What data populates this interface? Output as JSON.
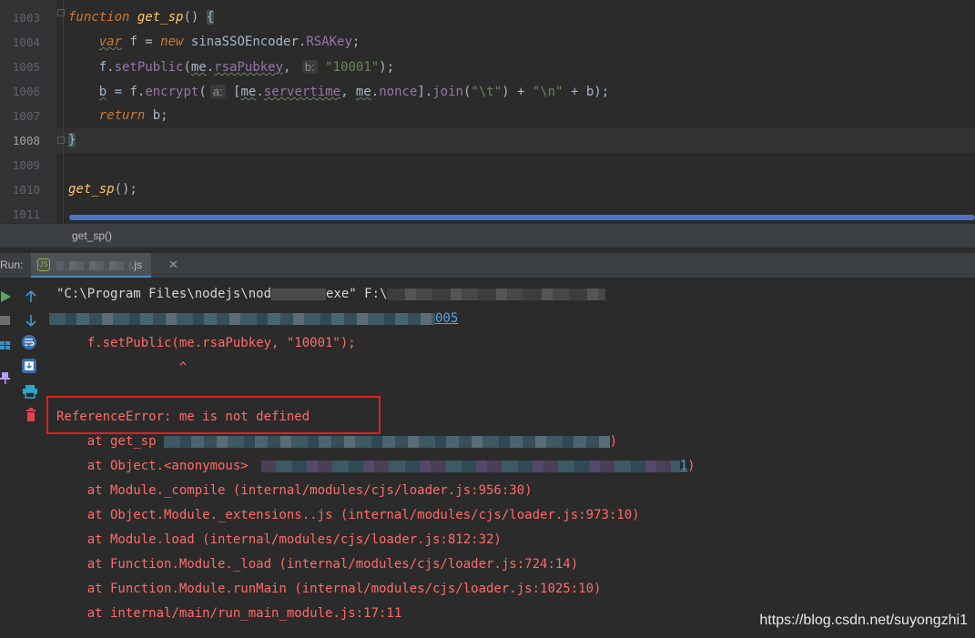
{
  "editor": {
    "line_numbers": [
      "1003",
      "1004",
      "1005",
      "1006",
      "1007",
      "1008",
      "1009",
      "1010",
      "1011"
    ],
    "current_line": "1008",
    "lines": [
      {
        "parts": [
          {
            "t": "function",
            "c": "kw"
          },
          {
            "t": " "
          },
          {
            "t": "get_sp",
            "c": "fn"
          },
          {
            "t": "() "
          },
          {
            "t": "{",
            "c": "brace-match"
          }
        ]
      },
      {
        "parts": [
          {
            "t": "    "
          },
          {
            "t": "var",
            "c": "kw squig"
          },
          {
            "t": " f = "
          },
          {
            "t": "new",
            "c": "kw"
          },
          {
            "t": " sinaSSOEncoder."
          },
          {
            "t": "RSAKey",
            "c": "prop"
          },
          {
            "t": ";"
          }
        ]
      },
      {
        "parts": [
          {
            "t": "    f."
          },
          {
            "t": "setPublic",
            "c": "prop"
          },
          {
            "t": "("
          },
          {
            "t": "me",
            "c": "squig"
          },
          {
            "t": "."
          },
          {
            "t": "rsaPubkey",
            "c": "prop squig"
          },
          {
            "t": ", "
          },
          {
            "t": "b:",
            "c": "hint"
          },
          {
            "t": " "
          },
          {
            "t": "\"10001\"",
            "c": "str"
          },
          {
            "t": ");"
          }
        ]
      },
      {
        "parts": [
          {
            "t": "    "
          },
          {
            "t": "b",
            "c": "squig"
          },
          {
            "t": " = f."
          },
          {
            "t": "encrypt",
            "c": "prop"
          },
          {
            "t": "("
          },
          {
            "t": "a:",
            "c": "hint"
          },
          {
            "t": " ["
          },
          {
            "t": "me",
            "c": "squig"
          },
          {
            "t": "."
          },
          {
            "t": "servertime",
            "c": "prop squig"
          },
          {
            "t": ", "
          },
          {
            "t": "me",
            "c": "squig"
          },
          {
            "t": "."
          },
          {
            "t": "nonce",
            "c": "prop"
          },
          {
            "t": "]."
          },
          {
            "t": "join",
            "c": "prop"
          },
          {
            "t": "("
          },
          {
            "t": "\"\\t\"",
            "c": "str"
          },
          {
            "t": ") + "
          },
          {
            "t": "\"\\n\"",
            "c": "str"
          },
          {
            "t": " + b);"
          }
        ]
      },
      {
        "parts": [
          {
            "t": "    "
          },
          {
            "t": "return",
            "c": "kw"
          },
          {
            "t": " b;"
          }
        ]
      },
      {
        "parts": [
          {
            "t": "}",
            "c": "brace-match"
          }
        ]
      },
      {
        "parts": []
      },
      {
        "parts": [
          {
            "t": "get_sp",
            "c": "fn"
          },
          {
            "t": "();"
          }
        ]
      },
      {
        "parts": []
      }
    ]
  },
  "breadcrumb": "get_sp()",
  "run": {
    "label": "Run:",
    "tab_label": ".js",
    "tab_close": "✕",
    "tab_icon": "JS"
  },
  "console": {
    "cmd_visible": "\"C:\\Program Files\\nodejs\\nod",
    "cmd_after": "exe\" F:\\",
    "line2_link": "005",
    "source_line": "    f.setPublic(me.rsaPubkey, \"10001\");",
    "caret_line": "                ^",
    "error": "ReferenceError: me is not defined",
    "stack": [
      "    at get_sp",
      "    at Object.<anonymous>",
      "    at Module._compile (internal/modules/cjs/loader.js:956:30)",
      "    at Object.Module._extensions..js (internal/modules/cjs/loader.js:973:10)",
      "    at Module.load (internal/modules/cjs/loader.js:812:32)",
      "    at Function.Module._load (internal/modules/cjs/loader.js:724:14)",
      "    at Function.Module.runMain (internal/modules/cjs/loader.js:1025:10)",
      "    at internal/main/run_main_module.js:17:11"
    ],
    "stack0_tail": ")",
    "stack1_link": "1",
    "stack1_tail": ")"
  },
  "toolbar_icons": [
    "rerun-icon",
    "stop-icon",
    "layout-icon",
    "pin-icon"
  ],
  "side_icons": [
    "up-arrow-icon",
    "down-arrow-icon",
    "soft-wrap-icon",
    "scroll-to-end-icon",
    "print-icon",
    "trash-icon"
  ],
  "watermark": "https://blog.csdn.net/suyongzhi1"
}
